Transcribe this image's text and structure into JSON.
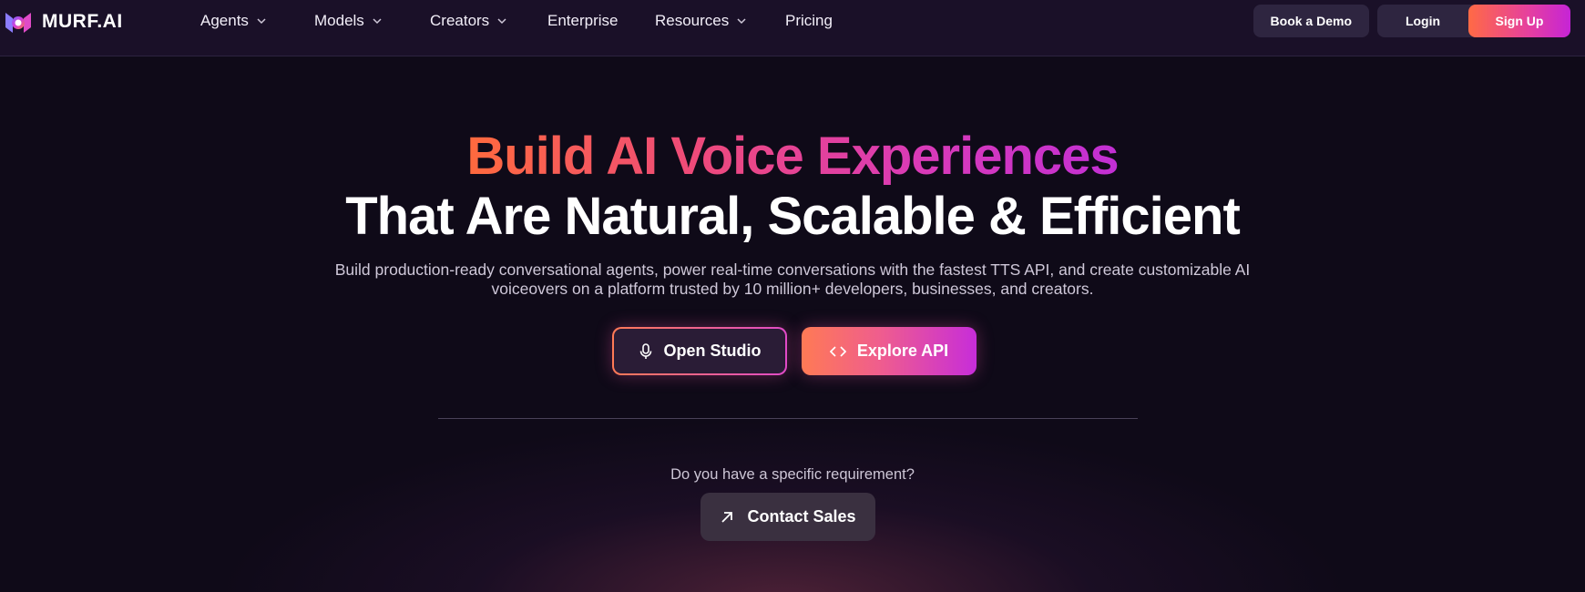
{
  "brand": {
    "name": "MURF.AI"
  },
  "nav": {
    "items": [
      {
        "label": "Agents",
        "dropdown": true
      },
      {
        "label": "Models",
        "dropdown": true
      },
      {
        "label": "Creators",
        "dropdown": true
      },
      {
        "label": "Enterprise",
        "dropdown": false
      },
      {
        "label": "Resources",
        "dropdown": true
      },
      {
        "label": "Pricing",
        "dropdown": false
      }
    ],
    "book_demo": "Book a Demo",
    "login": "Login",
    "signup": "Sign Up"
  },
  "hero": {
    "title_gradient": "Build AI Voice Experiences",
    "title_white": "That Are Natural, Scalable & Efficient",
    "subtitle_line1": "Build production-ready conversational agents, power real-time conversations with the fastest TTS API, and create customizable AI",
    "subtitle_line2": "voiceovers on a platform trusted by 10 million+ developers, businesses, and creators.",
    "open_studio": "Open Studio",
    "explore_api": "Explore API",
    "requirement_question": "Do you have a specific requirement?",
    "contact_sales": "Contact Sales"
  },
  "icons": {
    "open_studio": "microphone-icon",
    "explore_api": "code-brackets-icon",
    "contact_sales": "arrow-up-right-icon",
    "dropdown": "chevron-down-icon"
  },
  "colors": {
    "background": "#0f0a18",
    "nav_bg": "#1a1028",
    "accent_orange": "#ff6a45",
    "accent_magenta": "#c524d6"
  }
}
